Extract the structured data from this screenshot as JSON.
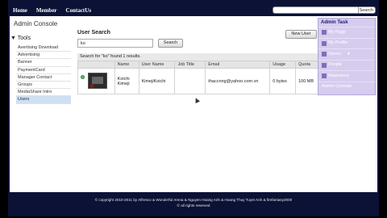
{
  "nav": {
    "home": "Home",
    "member": "Member",
    "contact": "ContactUs"
  },
  "top_search": {
    "value": "",
    "button": "Search"
  },
  "sidebar": {
    "title": "Admin Console",
    "tools_label": "Tools",
    "items": [
      {
        "label": "Avertising Download"
      },
      {
        "label": "Advertising"
      },
      {
        "label": "Banner"
      },
      {
        "label": "PaymentCard"
      },
      {
        "label": "Manager Contact"
      },
      {
        "label": "Groups"
      },
      {
        "label": "MediaShare Intro"
      },
      {
        "label": "Users"
      }
    ]
  },
  "main": {
    "title": "User Search",
    "search_value": "ko",
    "search_button": "Search",
    "new_user_button": "New User",
    "result_text": "Search for \"ko\" found 1 results.",
    "columns": [
      "",
      "Name",
      "User Name",
      "Job Title",
      "Email",
      "Usage",
      "Quota"
    ],
    "rows": [
      {
        "name": "Koichi Kimeji",
        "username": "KimejiKoichi",
        "job": "",
        "email": "thaccnng@yahoo.com.vn",
        "usage": "0 bytes",
        "quota": "100 MB"
      }
    ]
  },
  "admin_task": {
    "title": "Admin Task",
    "items": [
      {
        "label": "My Page"
      },
      {
        "label": "My Profile"
      },
      {
        "label": "Stores"
      },
      {
        "label": "People"
      },
      {
        "label": "Repository"
      },
      {
        "label": "Admin Console"
      }
    ]
  },
  "footer": {
    "copyright": "© copyright 2010-2011 by Alfresco & Wonderful Arena & Nguyen Hoang Anh & Hoang Thuy Tuyet Anh & firefantasy2000",
    "rights": "© all rights reserved"
  }
}
